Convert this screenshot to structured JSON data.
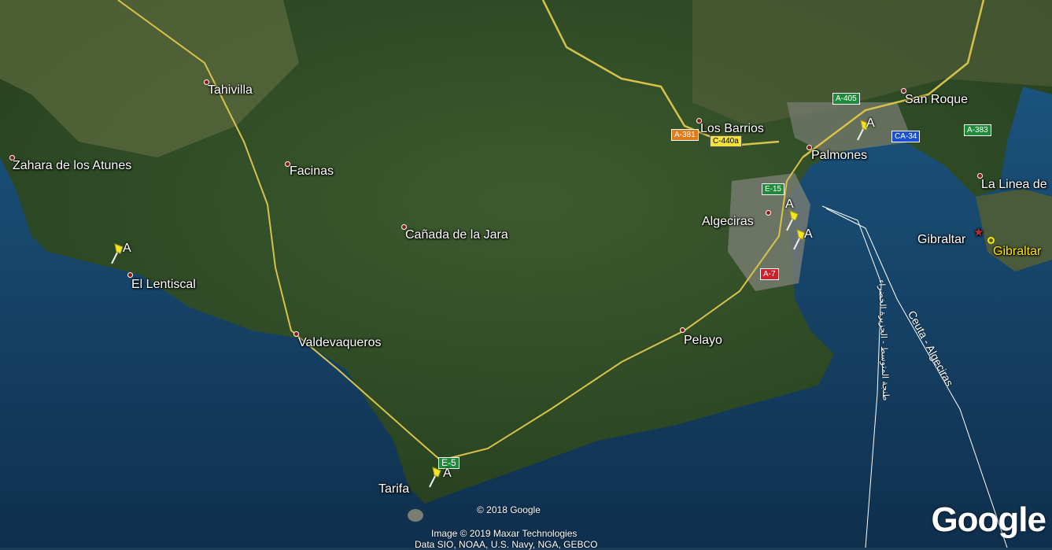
{
  "map": {
    "places": [
      {
        "name": "Tahivilla",
        "key": "tahivilla"
      },
      {
        "name": "Zahara de los Atunes",
        "key": "zahara"
      },
      {
        "name": "Facinas",
        "key": "facinas"
      },
      {
        "name": "Cañada de la Jara",
        "key": "canada"
      },
      {
        "name": "El Lentiscal",
        "key": "lentiscal"
      },
      {
        "name": "Valdevaqueros",
        "key": "valdevaqueros"
      },
      {
        "name": "Pelayo",
        "key": "pelayo"
      },
      {
        "name": "Tarifa",
        "key": "tarifa"
      },
      {
        "name": "Los Barrios",
        "key": "losbarrios"
      },
      {
        "name": "Palmones",
        "key": "palmones"
      },
      {
        "name": "San Roque",
        "key": "sanroque"
      },
      {
        "name": "La Linea de",
        "key": "lalinea"
      },
      {
        "name": "Algeciras",
        "key": "algeciras"
      },
      {
        "name": "Gibraltar",
        "key": "gibraltar"
      }
    ],
    "highlight_place": "Gibraltar",
    "roads": [
      "A-381",
      "C-440a",
      "A-405",
      "CA-34",
      "A-383",
      "E-15",
      "A-7",
      "E-5"
    ],
    "pin_label": "A",
    "ferry_route": "Ceuta - Algeciras",
    "ferry_route_arabic": "طنجة المتوسط - الجزيرة الخضراء",
    "credits": {
      "copyright": "© 2018 Google",
      "imagery": "Image © 2019 Maxar Technologies",
      "data": "Data SIO, NOAA, U.S. Navy, NGA, GEBCO"
    },
    "logo": "Google",
    "colors": {
      "land_dark": "#2f4a25",
      "land_light": "#6b7a4a",
      "sea": "#1b4a72",
      "road": "#d8c24a",
      "highlight": "#ffe600"
    }
  }
}
